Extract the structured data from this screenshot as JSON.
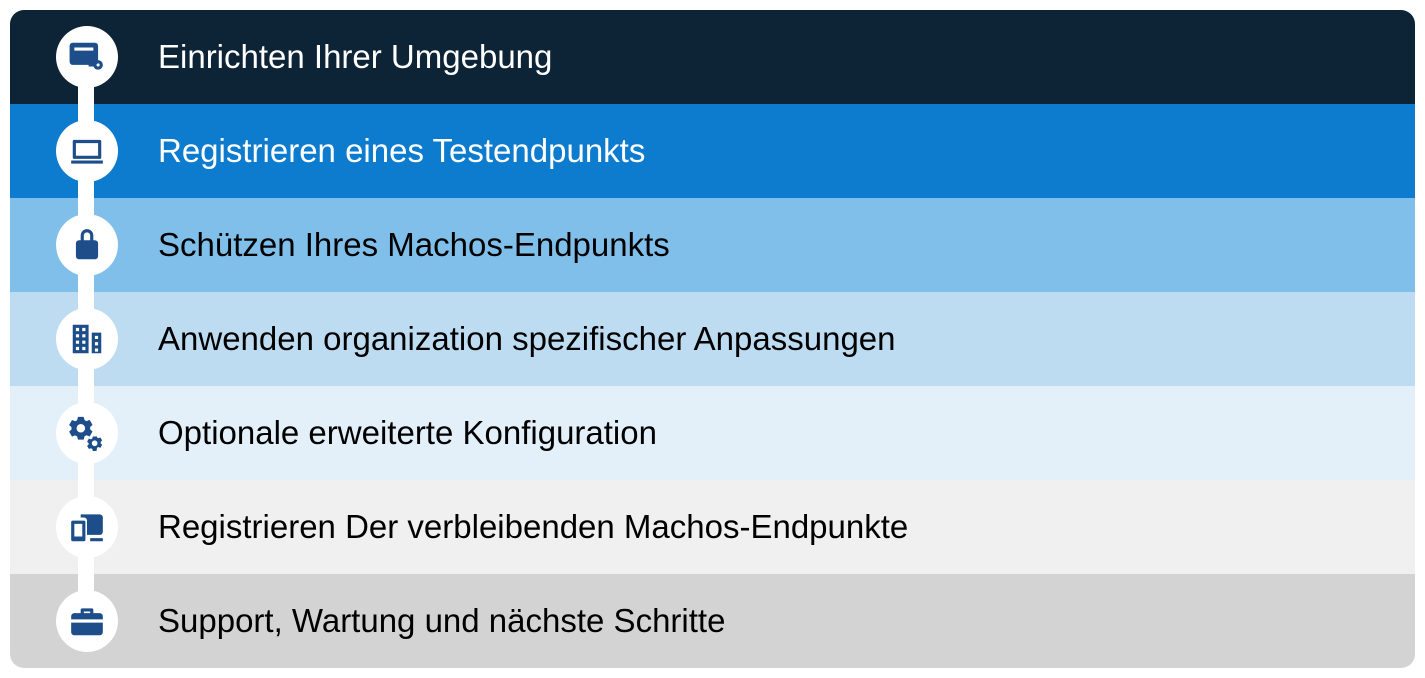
{
  "steps": [
    {
      "label": "Einrichten Ihrer Umgebung",
      "icon": "server-key-icon"
    },
    {
      "label": "Registrieren eines Testendpunkts",
      "icon": "laptop-icon"
    },
    {
      "label": "Schützen Ihres Machos-Endpunkts",
      "icon": "lock-icon"
    },
    {
      "label": "Anwenden organization spezifischer Anpassungen",
      "icon": "building-icon"
    },
    {
      "label": "Optionale erweiterte Konfiguration",
      "icon": "gears-icon"
    },
    {
      "label": "Registrieren Der verbleibenden Machos-Endpunkte",
      "icon": "devices-icon"
    },
    {
      "label": "Support, Wartung und nächste Schritte",
      "icon": "briefcase-icon"
    }
  ]
}
